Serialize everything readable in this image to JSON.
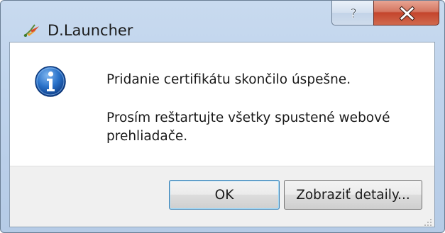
{
  "window": {
    "title": "D.Launcher"
  },
  "titlebar": {
    "help_icon": "question-icon",
    "close_icon": "close-icon"
  },
  "message": {
    "icon": "info-icon",
    "line1": "Pridanie certifikátu skončilo úspešne.",
    "line2": "Prosím reštartujte všetky spustené webové prehliadače."
  },
  "buttons": {
    "ok_label": "OK",
    "details_label": "Zobraziť detaily..."
  },
  "colors": {
    "close_button": "#c4452c",
    "info_icon": "#1a5fb4",
    "default_button_border": "#3c7fb1"
  }
}
